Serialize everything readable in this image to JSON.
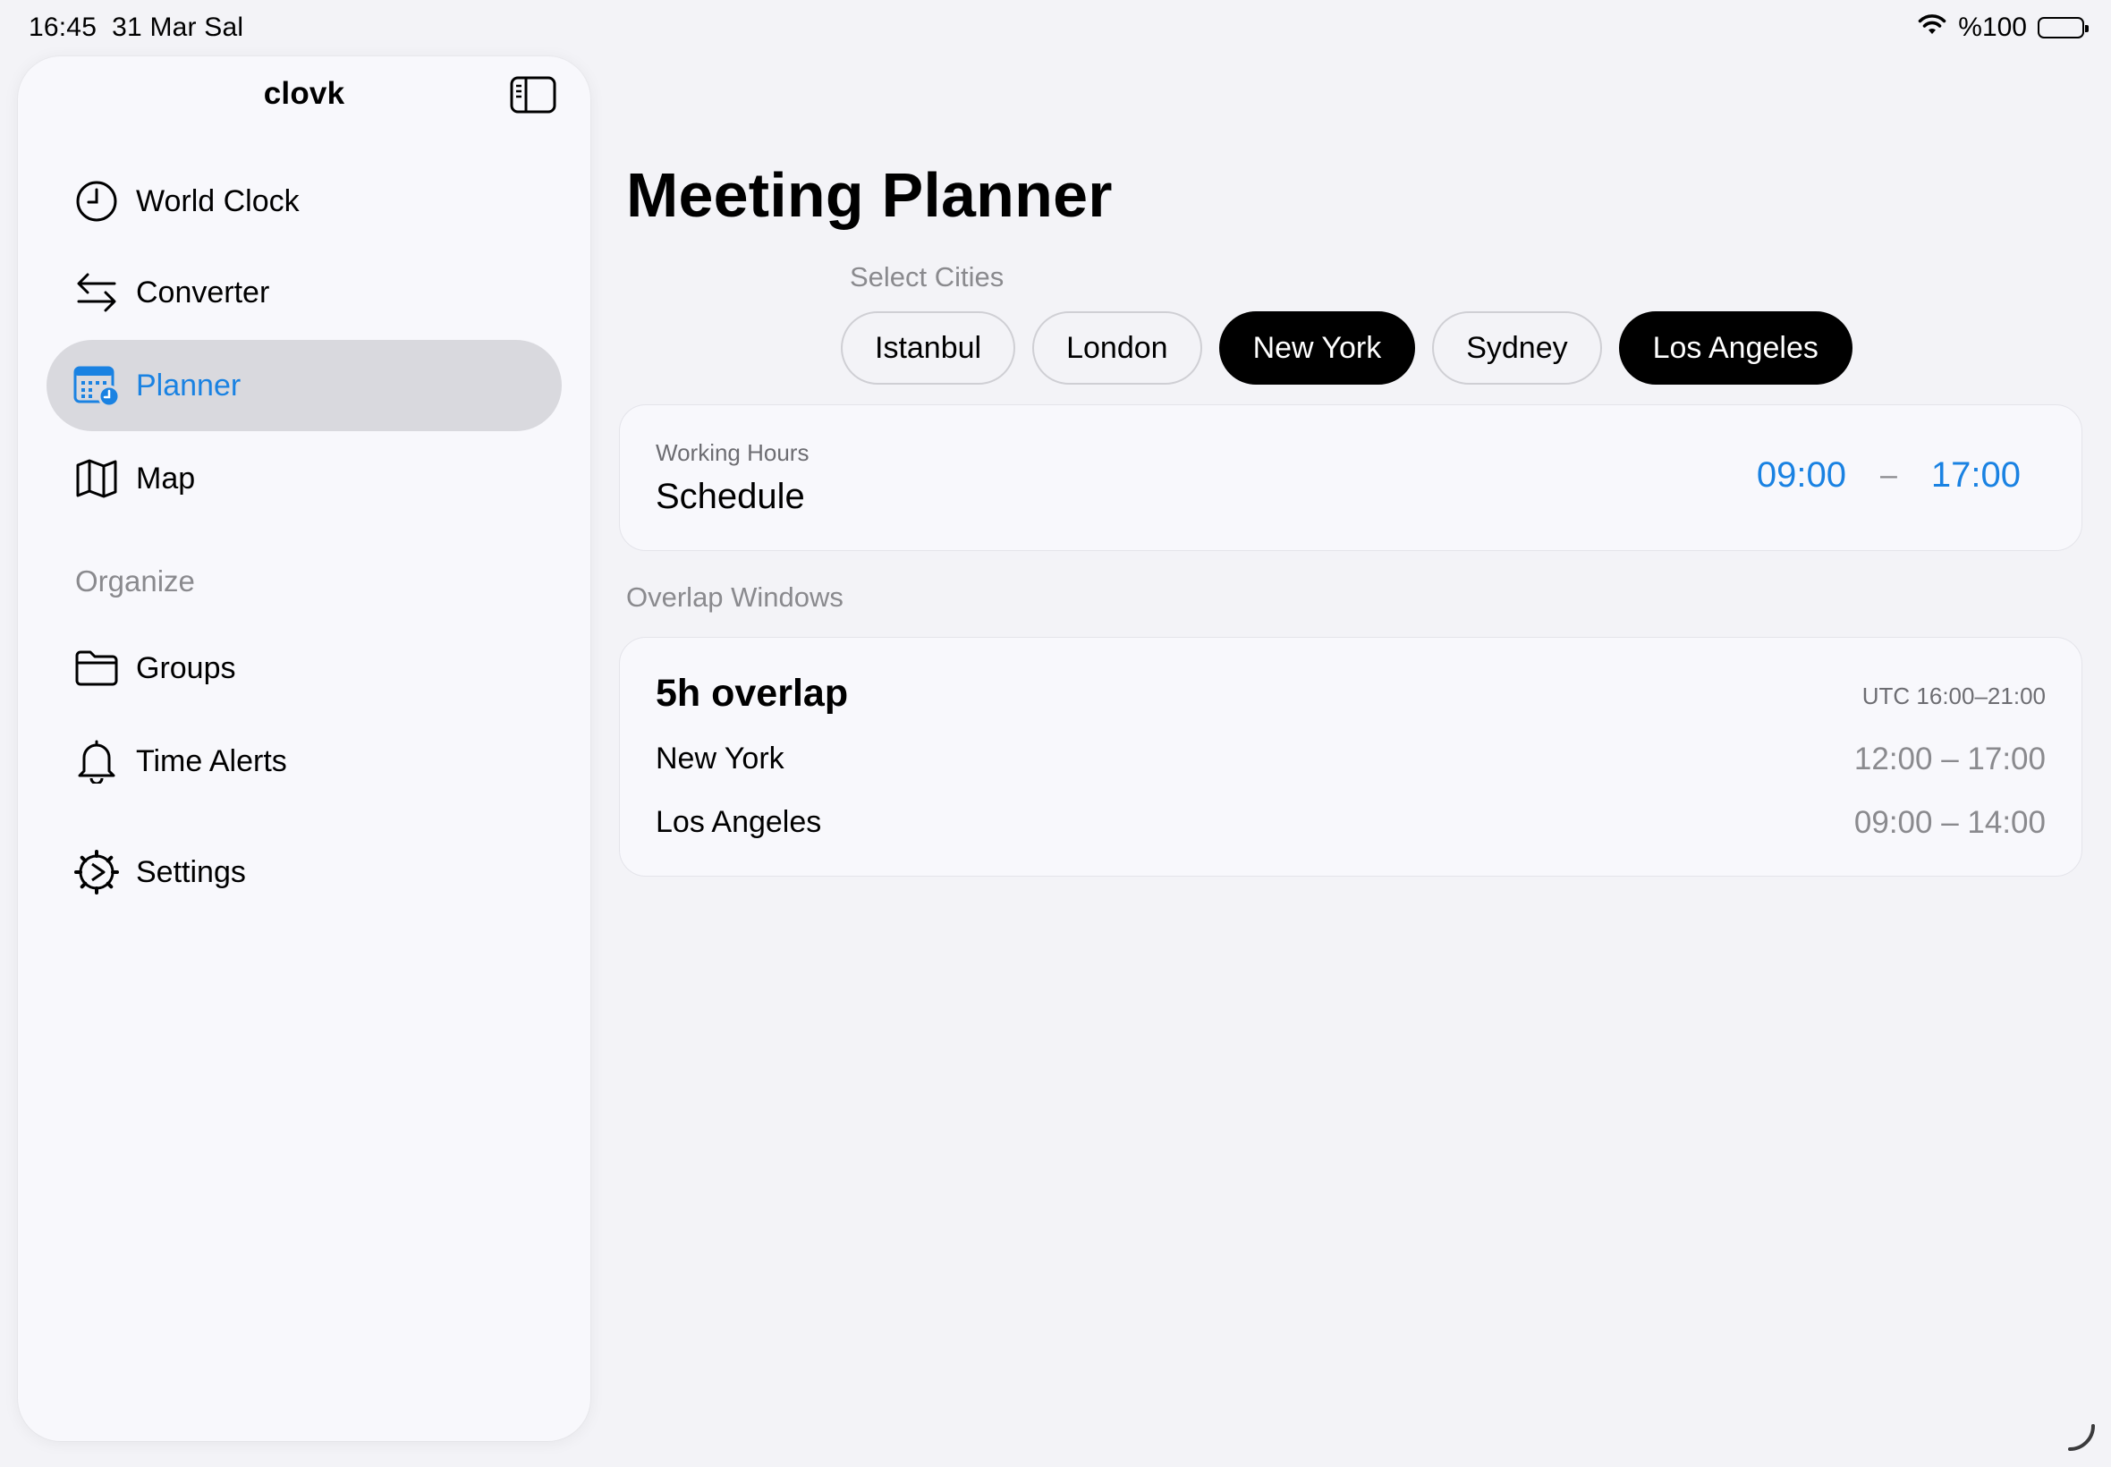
{
  "status": {
    "time": "16:45",
    "date": "31 Mar Sal",
    "battery": "%100",
    "icons": [
      "wifi-icon",
      "battery-icon"
    ]
  },
  "sidebar": {
    "title": "clovk",
    "toggle_icon": "sidebar-toggle-icon",
    "items": [
      {
        "label": "World Clock",
        "icon": "clock-icon"
      },
      {
        "label": "Converter",
        "icon": "arrows-exchange-icon"
      },
      {
        "label": "Planner",
        "icon": "calendar-clock-icon",
        "active": true
      },
      {
        "label": "Map",
        "icon": "map-icon"
      }
    ],
    "section": "Organize",
    "organize_items": [
      {
        "label": "Groups",
        "icon": "folder-icon"
      },
      {
        "label": "Time Alerts",
        "icon": "bell-icon"
      }
    ],
    "settings": {
      "label": "Settings",
      "icon": "gear-icon"
    }
  },
  "main": {
    "title": "Meeting Planner",
    "select_label": "Select Cities",
    "cities": [
      {
        "label": "Istanbul",
        "selected": false
      },
      {
        "label": "London",
        "selected": false
      },
      {
        "label": "New York",
        "selected": true
      },
      {
        "label": "Sydney",
        "selected": false
      },
      {
        "label": "Los Angeles",
        "selected": true
      }
    ],
    "working_hours": {
      "kicker": "Working Hours",
      "title": "Schedule",
      "start": "09:00",
      "separator": "–",
      "end": "17:00"
    },
    "overlap_label": "Overlap Windows",
    "overlap": {
      "title": "5h overlap",
      "utc": "UTC 16:00–21:00",
      "rows": [
        {
          "city": "New York",
          "range": "12:00 – 17:00"
        },
        {
          "city": "Los Angeles",
          "range": "09:00 – 14:00"
        }
      ]
    }
  },
  "colors": {
    "accent": "#1a82e2",
    "background": "#f3f3f7",
    "sidebar_bg": "#f8f8fc",
    "active_row": "#d9d9de",
    "secondary_text": "#8a8a8e"
  }
}
